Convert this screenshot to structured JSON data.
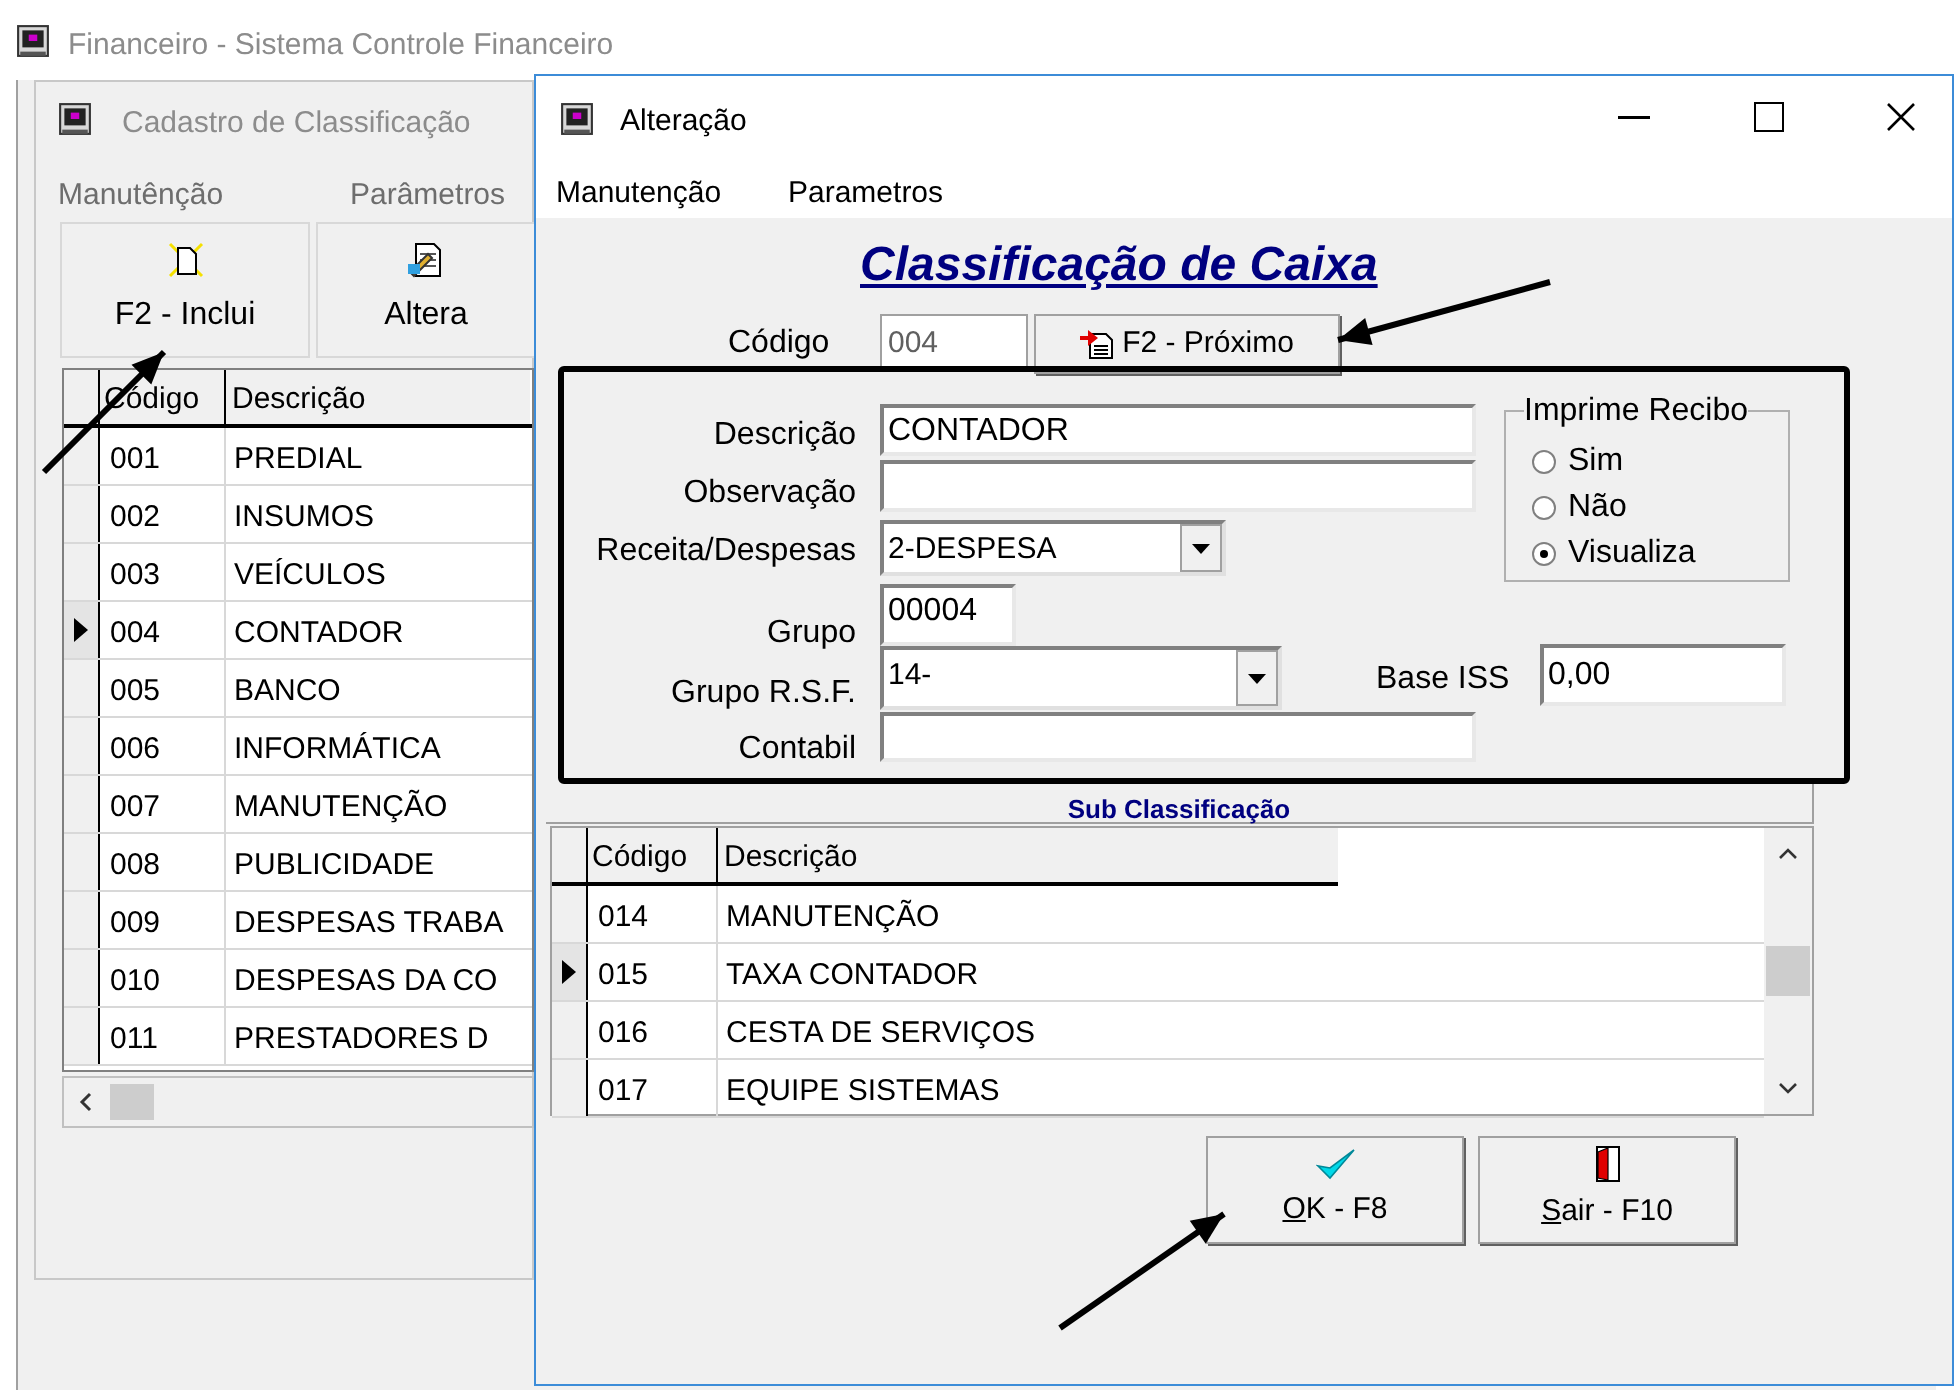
{
  "app_title": "Financeiro - Sistema Controle Financeiro",
  "back_window": {
    "title": "Cadastro de Classificação",
    "menu": [
      "Manutênção",
      "Parâmetros"
    ],
    "toolbar": [
      {
        "kind": "new",
        "label": "F2 - Inclui"
      },
      {
        "kind": "edit",
        "label": "Altera"
      }
    ],
    "table": {
      "columns": [
        "Código",
        "Descrição"
      ],
      "rows": [
        {
          "cells": [
            "001",
            "PREDIAL"
          ],
          "selected": false
        },
        {
          "cells": [
            "002",
            "INSUMOS"
          ],
          "selected": false
        },
        {
          "cells": [
            "003",
            "VEÍCULOS"
          ],
          "selected": false
        },
        {
          "cells": [
            "004",
            "CONTADOR"
          ],
          "selected": true
        },
        {
          "cells": [
            "005",
            "BANCO"
          ],
          "selected": false
        },
        {
          "cells": [
            "006",
            "INFORMÁTICA"
          ],
          "selected": false
        },
        {
          "cells": [
            "007",
            "MANUTENÇÃO"
          ],
          "selected": false
        },
        {
          "cells": [
            "008",
            "PUBLICIDADE"
          ],
          "selected": false
        },
        {
          "cells": [
            "009",
            "DESPESAS TRABA"
          ],
          "selected": false
        },
        {
          "cells": [
            "010",
            "DESPESAS DA CO"
          ],
          "selected": false
        },
        {
          "cells": [
            "011",
            "PRESTADORES D"
          ],
          "selected": false
        }
      ]
    }
  },
  "dialog": {
    "title": "Alteração",
    "menu": [
      "Manutenção",
      "Parametros"
    ],
    "heading": "Classificação de Caixa",
    "codigo": {
      "label": "Código",
      "value": "004"
    },
    "next_button": "F2 - Próximo",
    "fields": [
      {
        "kind": "text",
        "label": "Descrição",
        "value": "CONTADOR"
      },
      {
        "kind": "text",
        "label": "Observação"
      },
      {
        "kind": "combo",
        "label": "Receita/Despesas",
        "value": "2-DESPESA"
      },
      {
        "kind": "text",
        "label": "Grupo",
        "value": "00004"
      },
      {
        "kind": "combo",
        "label": "Grupo R.S.F.",
        "value": "14-"
      },
      {
        "kind": "text",
        "label": "Contabil"
      }
    ],
    "base_iss": {
      "label": "Base ISS",
      "value": "0,00"
    },
    "receipt_group": {
      "title": "Imprime Recibo",
      "options": [
        {
          "label": "Sim",
          "selected": false
        },
        {
          "label": "Não",
          "selected": false
        },
        {
          "label": "Visualiza",
          "selected": true
        }
      ]
    },
    "sub_title": "Sub Classificação",
    "sub_table": {
      "columns": [
        "Código",
        "Descrição"
      ],
      "rows": [
        {
          "cells": [
            "014",
            "MANUTENÇÃO"
          ],
          "selected": false
        },
        {
          "cells": [
            "015",
            "TAXA CONTADOR"
          ],
          "selected": true
        },
        {
          "cells": [
            "016",
            "CESTA DE SERVIÇOS"
          ],
          "selected": false
        },
        {
          "cells": [
            "017",
            "EQUIPE SISTEMAS"
          ],
          "selected": false
        }
      ]
    },
    "buttons": [
      {
        "kind": "ok",
        "accel": "O",
        "rest": "K - F8"
      },
      {
        "kind": "exit",
        "accel": "S",
        "rest": "air - F10"
      }
    ]
  }
}
